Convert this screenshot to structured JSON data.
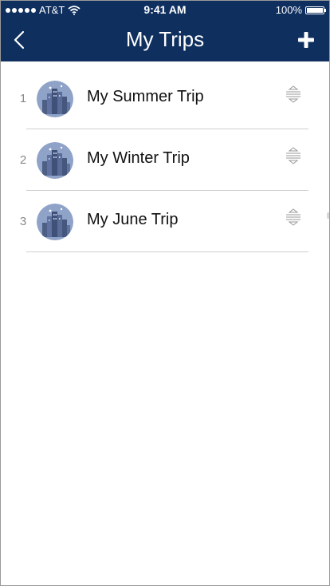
{
  "status_bar": {
    "carrier": "AT&T",
    "time": "9:41 AM",
    "battery": "100%"
  },
  "nav": {
    "title": "My Trips",
    "back_icon": "chevron-left-icon",
    "add_icon": "plus-icon"
  },
  "trips": [
    {
      "index": "1",
      "title": "My Summer Trip"
    },
    {
      "index": "2",
      "title": "My Winter Trip"
    },
    {
      "index": "3",
      "title": "My June Trip"
    }
  ],
  "colors": {
    "header_bg": "#0f2f5f",
    "avatar_bg": "#8fa2c8"
  }
}
